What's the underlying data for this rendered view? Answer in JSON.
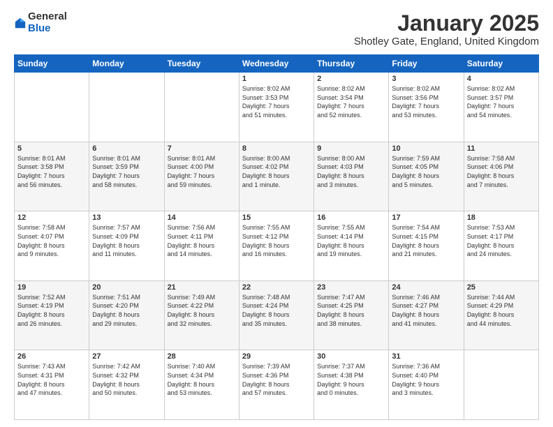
{
  "logo": {
    "general": "General",
    "blue": "Blue"
  },
  "title": "January 2025",
  "location": "Shotley Gate, England, United Kingdom",
  "days": [
    "Sunday",
    "Monday",
    "Tuesday",
    "Wednesday",
    "Thursday",
    "Friday",
    "Saturday"
  ],
  "weeks": [
    [
      {
        "day": "",
        "info": ""
      },
      {
        "day": "",
        "info": ""
      },
      {
        "day": "",
        "info": ""
      },
      {
        "day": "1",
        "info": "Sunrise: 8:02 AM\nSunset: 3:53 PM\nDaylight: 7 hours\nand 51 minutes."
      },
      {
        "day": "2",
        "info": "Sunrise: 8:02 AM\nSunset: 3:54 PM\nDaylight: 7 hours\nand 52 minutes."
      },
      {
        "day": "3",
        "info": "Sunrise: 8:02 AM\nSunset: 3:56 PM\nDaylight: 7 hours\nand 53 minutes."
      },
      {
        "day": "4",
        "info": "Sunrise: 8:02 AM\nSunset: 3:57 PM\nDaylight: 7 hours\nand 54 minutes."
      }
    ],
    [
      {
        "day": "5",
        "info": "Sunrise: 8:01 AM\nSunset: 3:58 PM\nDaylight: 7 hours\nand 56 minutes."
      },
      {
        "day": "6",
        "info": "Sunrise: 8:01 AM\nSunset: 3:59 PM\nDaylight: 7 hours\nand 58 minutes."
      },
      {
        "day": "7",
        "info": "Sunrise: 8:01 AM\nSunset: 4:00 PM\nDaylight: 7 hours\nand 59 minutes."
      },
      {
        "day": "8",
        "info": "Sunrise: 8:00 AM\nSunset: 4:02 PM\nDaylight: 8 hours\nand 1 minute."
      },
      {
        "day": "9",
        "info": "Sunrise: 8:00 AM\nSunset: 4:03 PM\nDaylight: 8 hours\nand 3 minutes."
      },
      {
        "day": "10",
        "info": "Sunrise: 7:59 AM\nSunset: 4:05 PM\nDaylight: 8 hours\nand 5 minutes."
      },
      {
        "day": "11",
        "info": "Sunrise: 7:58 AM\nSunset: 4:06 PM\nDaylight: 8 hours\nand 7 minutes."
      }
    ],
    [
      {
        "day": "12",
        "info": "Sunrise: 7:58 AM\nSunset: 4:07 PM\nDaylight: 8 hours\nand 9 minutes."
      },
      {
        "day": "13",
        "info": "Sunrise: 7:57 AM\nSunset: 4:09 PM\nDaylight: 8 hours\nand 11 minutes."
      },
      {
        "day": "14",
        "info": "Sunrise: 7:56 AM\nSunset: 4:11 PM\nDaylight: 8 hours\nand 14 minutes."
      },
      {
        "day": "15",
        "info": "Sunrise: 7:55 AM\nSunset: 4:12 PM\nDaylight: 8 hours\nand 16 minutes."
      },
      {
        "day": "16",
        "info": "Sunrise: 7:55 AM\nSunset: 4:14 PM\nDaylight: 8 hours\nand 19 minutes."
      },
      {
        "day": "17",
        "info": "Sunrise: 7:54 AM\nSunset: 4:15 PM\nDaylight: 8 hours\nand 21 minutes."
      },
      {
        "day": "18",
        "info": "Sunrise: 7:53 AM\nSunset: 4:17 PM\nDaylight: 8 hours\nand 24 minutes."
      }
    ],
    [
      {
        "day": "19",
        "info": "Sunrise: 7:52 AM\nSunset: 4:19 PM\nDaylight: 8 hours\nand 26 minutes."
      },
      {
        "day": "20",
        "info": "Sunrise: 7:51 AM\nSunset: 4:20 PM\nDaylight: 8 hours\nand 29 minutes."
      },
      {
        "day": "21",
        "info": "Sunrise: 7:49 AM\nSunset: 4:22 PM\nDaylight: 8 hours\nand 32 minutes."
      },
      {
        "day": "22",
        "info": "Sunrise: 7:48 AM\nSunset: 4:24 PM\nDaylight: 8 hours\nand 35 minutes."
      },
      {
        "day": "23",
        "info": "Sunrise: 7:47 AM\nSunset: 4:25 PM\nDaylight: 8 hours\nand 38 minutes."
      },
      {
        "day": "24",
        "info": "Sunrise: 7:46 AM\nSunset: 4:27 PM\nDaylight: 8 hours\nand 41 minutes."
      },
      {
        "day": "25",
        "info": "Sunrise: 7:44 AM\nSunset: 4:29 PM\nDaylight: 8 hours\nand 44 minutes."
      }
    ],
    [
      {
        "day": "26",
        "info": "Sunrise: 7:43 AM\nSunset: 4:31 PM\nDaylight: 8 hours\nand 47 minutes."
      },
      {
        "day": "27",
        "info": "Sunrise: 7:42 AM\nSunset: 4:32 PM\nDaylight: 8 hours\nand 50 minutes."
      },
      {
        "day": "28",
        "info": "Sunrise: 7:40 AM\nSunset: 4:34 PM\nDaylight: 8 hours\nand 53 minutes."
      },
      {
        "day": "29",
        "info": "Sunrise: 7:39 AM\nSunset: 4:36 PM\nDaylight: 8 hours\nand 57 minutes."
      },
      {
        "day": "30",
        "info": "Sunrise: 7:37 AM\nSunset: 4:38 PM\nDaylight: 9 hours\nand 0 minutes."
      },
      {
        "day": "31",
        "info": "Sunrise: 7:36 AM\nSunset: 4:40 PM\nDaylight: 9 hours\nand 3 minutes."
      },
      {
        "day": "",
        "info": ""
      }
    ]
  ]
}
